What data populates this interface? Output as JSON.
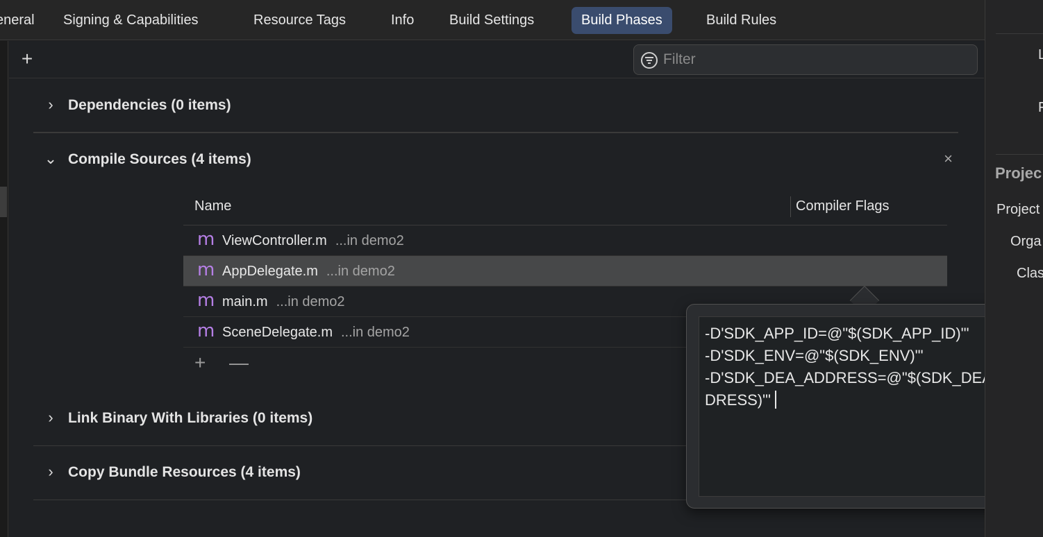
{
  "tabs": [
    {
      "label": "eneral",
      "active": false
    },
    {
      "label": "Signing & Capabilities",
      "active": false
    },
    {
      "label": "Resource Tags",
      "active": false
    },
    {
      "label": "Info",
      "active": false
    },
    {
      "label": "Build Settings",
      "active": false
    },
    {
      "label": "Build Phases",
      "active": true
    },
    {
      "label": "Build Rules",
      "active": false
    }
  ],
  "toolbar": {
    "add_label": "+",
    "filter_placeholder": "Filter"
  },
  "phases": {
    "dependencies": {
      "chevron": "›",
      "title": "Dependencies (0 items)"
    },
    "compile_sources": {
      "chevron": "⌄",
      "title": "Compile Sources (4 items)",
      "remove": "×"
    },
    "link_binary": {
      "chevron": "›",
      "title": "Link Binary With Libraries (0 items)"
    },
    "copy_bundle": {
      "chevron": "›",
      "title": "Copy Bundle Resources (4 items)"
    }
  },
  "compile_table": {
    "col_name": "Name",
    "col_flags": "Compiler Flags",
    "rows": [
      {
        "icon": "m",
        "name": "ViewController.m",
        "location": "...in demo2",
        "selected": false
      },
      {
        "icon": "m",
        "name": "AppDelegate.m",
        "location": "...in demo2",
        "selected": true
      },
      {
        "icon": "m",
        "name": "main.m",
        "location": "...in demo2",
        "selected": false
      },
      {
        "icon": "m",
        "name": "SceneDelegate.m",
        "location": "...in demo2",
        "selected": false
      }
    ],
    "add_label": "+",
    "remove_label": "—"
  },
  "popover": {
    "flags_text": "-D'SDK_APP_ID=@\"$(SDK_APP_ID)\"'\n-D'SDK_ENV=@\"$(SDK_ENV)\"'\n-D'SDK_DEA_ADDRESS=@\"$(SDK_DEA_ADDRESS)\"'"
  },
  "inspector": {
    "label_l": "L",
    "label_f": "F",
    "section": "Projec",
    "project": "Project",
    "organization": "Orga",
    "class": "Clas"
  },
  "colors": {
    "accent_tab": "#3a4c6e",
    "file_icon": "#b57fe5",
    "selected_row": "#474849"
  }
}
